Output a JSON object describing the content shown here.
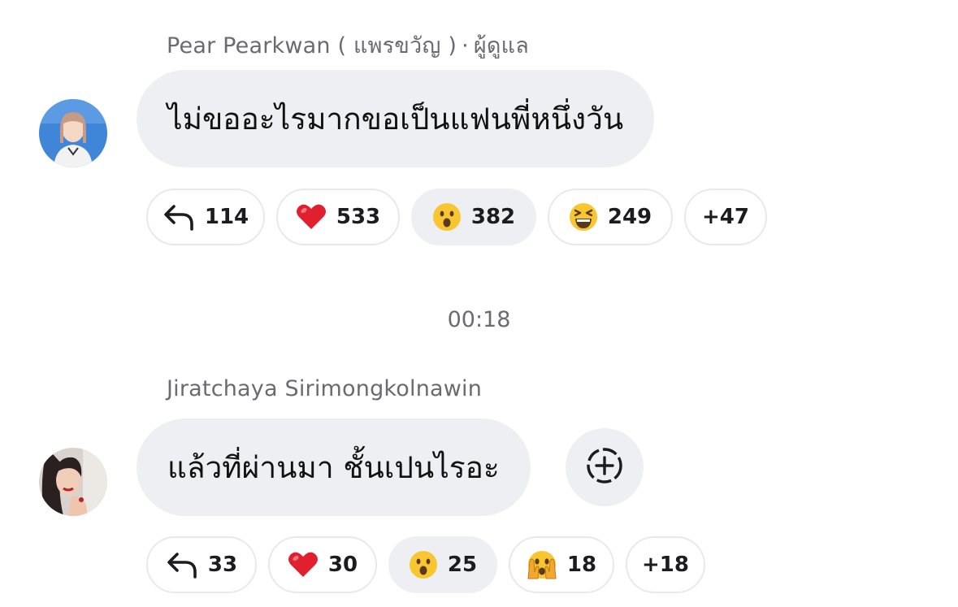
{
  "messages": [
    {
      "sender": "Pear Pearkwan ( แพรขวัญ )",
      "separator": "·",
      "role": "ผู้ดูแล",
      "text": "ไม่ขออะไรมากขอเป็นแฟนพี่หนึ่งวัน",
      "reactions": {
        "reply_count": "114",
        "heart_count": "533",
        "surprised_count": "382",
        "laugh_count": "249",
        "more_count": "+47"
      }
    },
    {
      "sender": "Jiratchaya Sirimongkolnawin",
      "text": "แล้วที่ผ่านมา ชั้นเปนไรอะ",
      "reactions": {
        "reply_count": "33",
        "heart_count": "30",
        "surprised_count": "25",
        "peek_count": "18",
        "more_count": "+18"
      }
    }
  ],
  "timestamp": "00:18",
  "colors": {
    "bubble_bg": "#eeeff3",
    "meta_text": "#6b6b6f",
    "heart": "#e0202f",
    "emoji_yellow": "#f8c630"
  },
  "icons": [
    "reply-arrow-icon",
    "heart-icon",
    "surprised-face-icon",
    "laughing-face-icon",
    "face-peeking-icon",
    "add-reaction-icon"
  ]
}
